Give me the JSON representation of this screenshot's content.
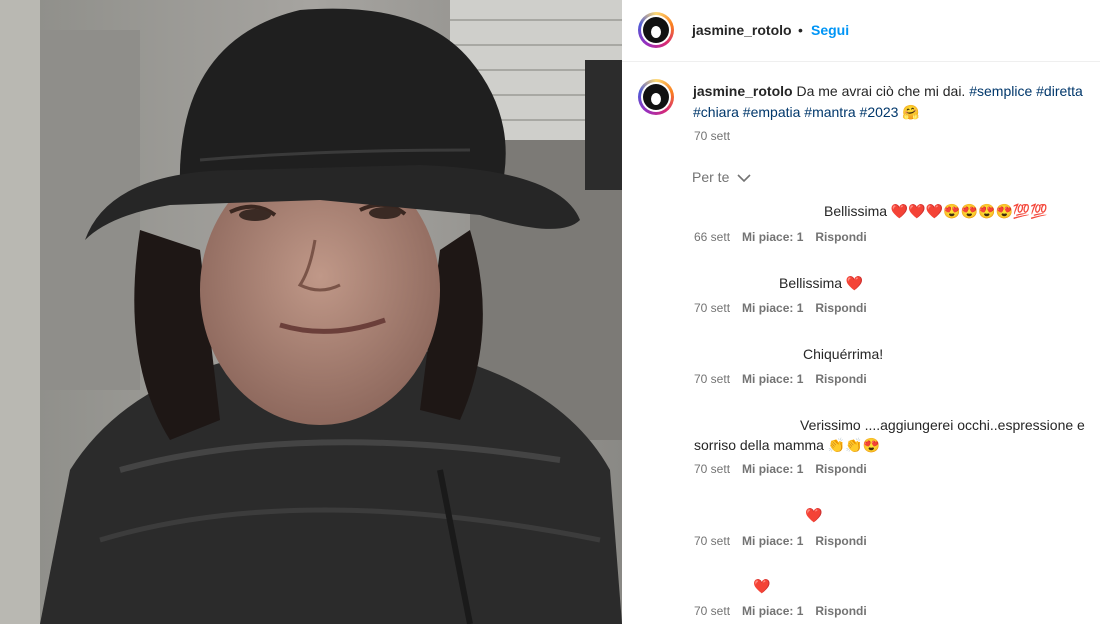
{
  "post": {
    "username": "jasmine_rotolo",
    "dot": "•",
    "follow_label": "Segui",
    "caption": {
      "username": "jasmine_rotolo",
      "text": "Da me avrai ciò che mi dai.",
      "tags_line1": "#semplice #diretta",
      "tags_line2": "#chiara #empatia #mantra #2023",
      "emoji": "🤗",
      "time": "70 sett"
    },
    "filter_label": "Per te",
    "filter_icon": "chevron-down-icon"
  },
  "comments": [
    {
      "text": "Bellissima ❤️❤️❤️😍😍😍😍💯💯",
      "time": "66 sett",
      "likes": "Mi piace: 1",
      "reply": "Rispondi"
    },
    {
      "text": "Bellissima ❤️",
      "time": "70 sett",
      "likes": "Mi piace: 1",
      "reply": "Rispondi"
    },
    {
      "text": "Chiquérrima!",
      "time": "70 sett",
      "likes": "Mi piace: 1",
      "reply": "Rispondi"
    },
    {
      "text_line1": "Verissimo ....aggiungerei occhi..espressione e",
      "text_line2": "sorriso della mamma 👏👏😍",
      "time": "70 sett",
      "likes": "Mi piace: 1",
      "reply": "Rispondi"
    },
    {
      "text": "❤️",
      "time": "70 sett",
      "likes": "Mi piace: 1",
      "reply": "Rispondi"
    },
    {
      "text": "❤️",
      "time": "70 sett",
      "likes": "Mi piace: 1",
      "reply": "Rispondi"
    }
  ],
  "colors": {
    "link": "#0095f6",
    "hashtag": "#00376b",
    "muted": "#737373"
  }
}
